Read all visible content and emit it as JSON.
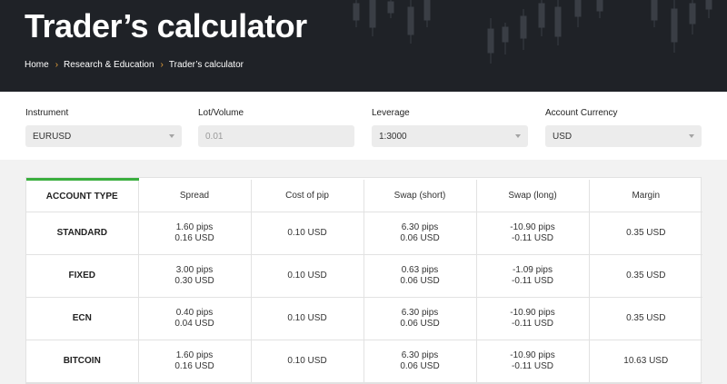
{
  "header": {
    "title": "Trader’s calculator",
    "breadcrumb": [
      "Home",
      "Research & Education",
      "Trader’s calculator"
    ]
  },
  "filters": {
    "instrument": {
      "label": "Instrument",
      "value": "EURUSD"
    },
    "lot": {
      "label": "Lot/Volume",
      "placeholder": "0.01"
    },
    "leverage": {
      "label": "Leverage",
      "value": "1:3000"
    },
    "currency": {
      "label": "Account Currency",
      "value": "USD"
    }
  },
  "table": {
    "columns": [
      "ACCOUNT TYPE",
      "Spread",
      "Cost of pip",
      "Swap (short)",
      "Swap (long)",
      "Margin"
    ],
    "rows": [
      {
        "type": "STANDARD",
        "spread": [
          "1.60 pips",
          "0.16 USD"
        ],
        "pip": "0.10 USD",
        "swap_short": [
          "6.30 pips",
          "0.06 USD"
        ],
        "swap_long": [
          "-10.90 pips",
          "-0.11 USD"
        ],
        "margin": "0.35 USD"
      },
      {
        "type": "FIXED",
        "spread": [
          "3.00 pips",
          "0.30 USD"
        ],
        "pip": "0.10 USD",
        "swap_short": [
          "0.63 pips",
          "0.06 USD"
        ],
        "swap_long": [
          "-1.09 pips",
          "-0.11 USD"
        ],
        "margin": "0.35 USD"
      },
      {
        "type": "ECN",
        "spread": [
          "0.40 pips",
          "0.04 USD"
        ],
        "pip": "0.10 USD",
        "swap_short": [
          "6.30 pips",
          "0.06 USD"
        ],
        "swap_long": [
          "-10.90 pips",
          "-0.11 USD"
        ],
        "margin": "0.35 USD"
      },
      {
        "type": "BITCOIN",
        "spread": [
          "1.60 pips",
          "0.16 USD"
        ],
        "pip": "0.10 USD",
        "swap_short": [
          "6.30 pips",
          "0.06 USD"
        ],
        "swap_long": [
          "-10.90 pips",
          "-0.11 USD"
        ],
        "margin": "10.63 USD"
      }
    ]
  },
  "colors": {
    "header_bg": "#1f2227",
    "accent_green": "#3aae3e",
    "breadcrumb_separator": "#e9a23b"
  }
}
